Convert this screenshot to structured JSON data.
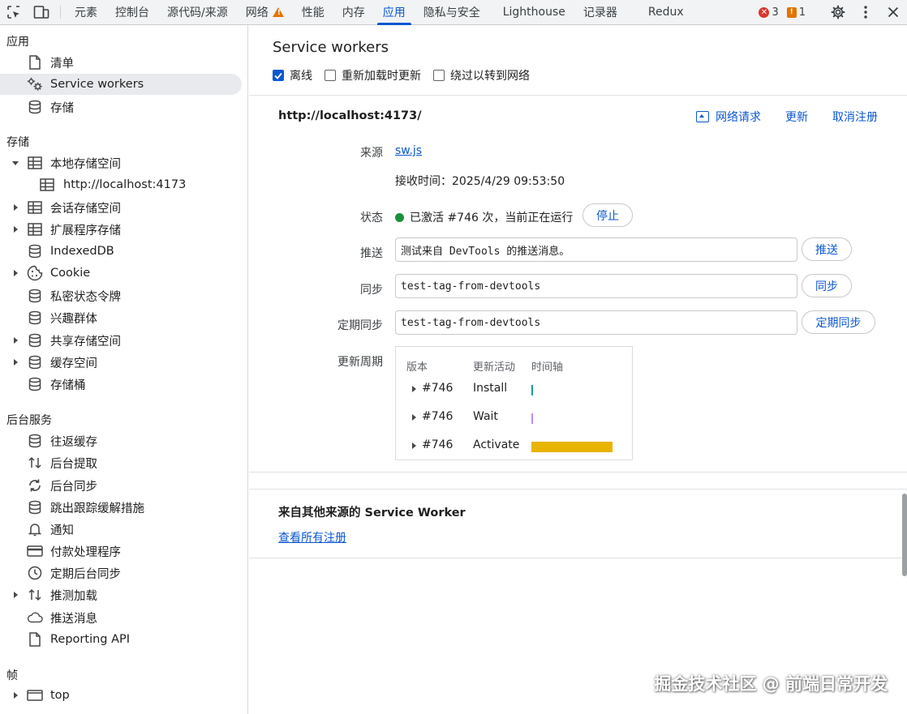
{
  "toolbar": {
    "tabs": [
      "元素",
      "控制台",
      "源代码/来源",
      "网络",
      "性能",
      "内存",
      "应用",
      "隐私与安全",
      "Lighthouse",
      "记录器",
      "Redux"
    ],
    "active_tab": "应用",
    "error_count": "3",
    "issue_count": "1",
    "accent": "#0b57d0",
    "warning_color": "#e37400",
    "error_color": "#dc362e"
  },
  "sidebar": {
    "app_heading": "应用",
    "app_items": [
      "清单",
      "Service workers",
      "存储"
    ],
    "storage_heading": "存储",
    "storage_items": [
      "本地存储空间",
      "http://localhost:4173",
      "会话存储空间",
      "扩展程序存储",
      "IndexedDB",
      "Cookie",
      "私密状态令牌",
      "兴趣群体",
      "共享存储空间",
      "缓存空间",
      "存储桶"
    ],
    "bg_heading": "后台服务",
    "bg_items": [
      "往返缓存",
      "后台提取",
      "后台同步",
      "跳出跟踪缓解措施",
      "通知",
      "付款处理程序",
      "定期后台同步",
      "推测加载",
      "推送消息",
      "Reporting API"
    ],
    "frames_heading": "帧",
    "frames_items": [
      "top"
    ]
  },
  "main": {
    "title": "Service workers",
    "options": [
      {
        "label": "离线",
        "checked": true
      },
      {
        "label": "重新加载时更新",
        "checked": false
      },
      {
        "label": "绕过以转到网络",
        "checked": false
      }
    ],
    "origin": "http://localhost:4173/",
    "actions": {
      "network": "网络请求",
      "update": "更新",
      "unregister": "取消注册"
    },
    "source_label": "来源",
    "source_file": "sw.js",
    "received": "接收时间：2025/4/29 09:53:50",
    "status_label": "状态",
    "status_text": "已激活 #746 次，当前正在运行",
    "status_color": "#1e8e3e",
    "stop_button": "停止",
    "push_label": "推送",
    "push_value": "测试来自 DevTools 的推送消息。",
    "push_button": "推送",
    "sync_label": "同步",
    "sync_value": "test-tag-from-devtools",
    "sync_button": "同步",
    "periodic_label": "定期同步",
    "periodic_value": "test-tag-from-devtools",
    "periodic_button": "定期同步",
    "cycle_label": "更新周期",
    "cycle": {
      "headers": [
        "版本",
        "更新活动",
        "时间轴"
      ],
      "rows": [
        {
          "version": "#746",
          "activity": "Install"
        },
        {
          "version": "#746",
          "activity": "Wait"
        },
        {
          "version": "#746",
          "activity": "Activate"
        }
      ],
      "timeline_install_color": "#1a9a9a",
      "timeline_wait_color": "#c58af9",
      "timeline_activate_color": "#e8b400"
    },
    "other_title": "来自其他来源的 Service Worker",
    "other_link": "查看所有注册"
  },
  "watermark": "掘金技术社区 @ 前端日常开发"
}
